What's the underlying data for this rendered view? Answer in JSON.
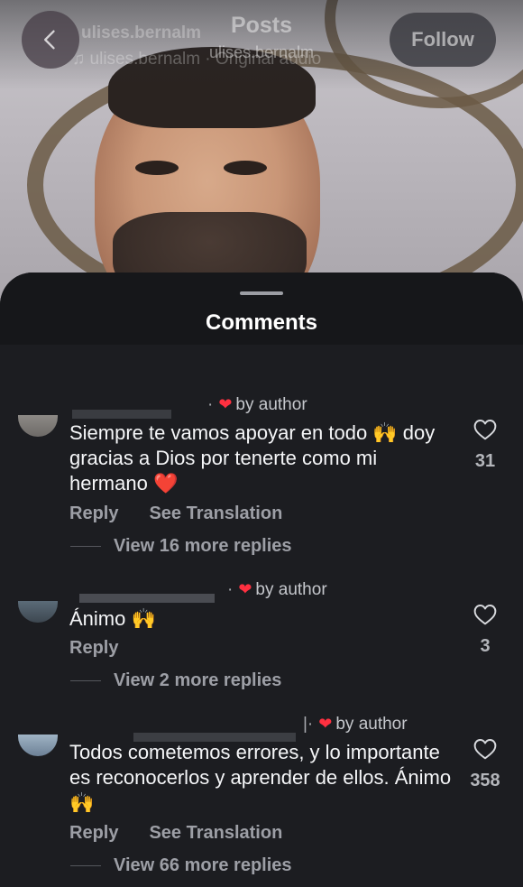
{
  "header": {
    "title": "Posts",
    "subtitle_username": "ulises.bernalm",
    "ghost_username": "ulises.bernalm",
    "ghost_audio": "♫ ulises.bernalm · Original audio",
    "follow_label": "Follow"
  },
  "sheet": {
    "title": "Comments"
  },
  "comments": [
    {
      "liked_by_author": "by author",
      "text": "Siempre te vamos apoyar  en todo 🙌 doy gracias a Dios por tenerte como mi hermano ❤️",
      "reply_label": "Reply",
      "translate_label": "See Translation",
      "view_replies": "View 16 more replies",
      "likes": "31"
    },
    {
      "liked_by_author": "by author",
      "text": "Ánimo 🙌",
      "reply_label": "Reply",
      "view_replies": "View 2 more replies",
      "likes": "3"
    },
    {
      "liked_by_author": "by author",
      "text": "Todos cometemos errores, y lo importante es reconocerlos y aprender de ellos.  Ánimo 🙌",
      "reply_label": "Reply",
      "translate_label": "See Translation",
      "view_replies": "View 66 more replies",
      "likes": "358"
    }
  ],
  "icons": {
    "back": "chevron-left-icon",
    "like": "heart-outline-icon",
    "author_like": "heart-filled-icon"
  },
  "colors": {
    "sheet_background": "#1c1d21",
    "author_heart": "#ff3040",
    "secondary_text": "#9d9fa6"
  }
}
